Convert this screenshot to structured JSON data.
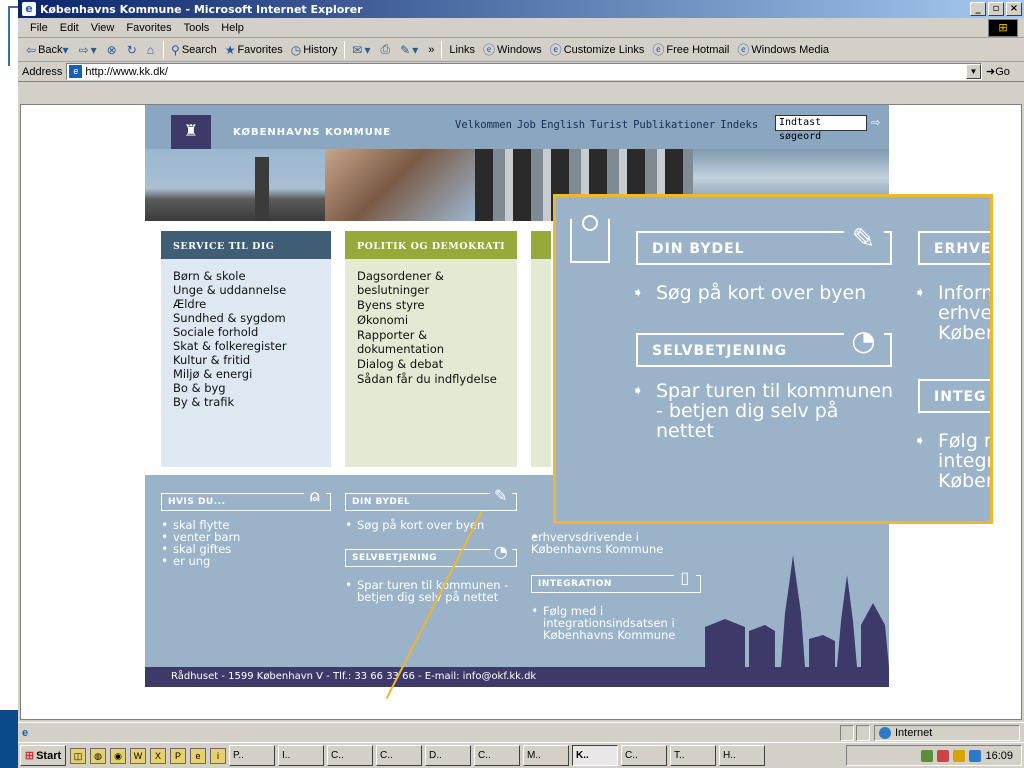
{
  "window": {
    "title": "Københavns Kommune - Microsoft Internet Explorer",
    "buttons": [
      "_",
      "▫",
      "×"
    ]
  },
  "menu": [
    "File",
    "Edit",
    "View",
    "Favorites",
    "Tools",
    "Help"
  ],
  "toolbar": {
    "back": "Back",
    "search": "Search",
    "favorites": "Favorites",
    "history": "History",
    "chevron": "»",
    "links_label": "Links",
    "links": [
      "Windows",
      "Customize Links",
      "Free Hotmail",
      "Windows Media"
    ]
  },
  "address": {
    "label": "Address",
    "url": "http://www.kk.dk/",
    "go": "Go"
  },
  "site": {
    "name": "KØBENHAVNS KOMMUNE",
    "topnav": [
      "Velkommen",
      "Job",
      "English",
      "Turist",
      "Publikationer",
      "Indeks"
    ],
    "search_placeholder": "Indtast søgeord",
    "service": {
      "title": "SERVICE TIL DIG",
      "items": [
        "Børn & skole",
        "Unge & uddannelse",
        "Ældre",
        "Sundhed & sygdom",
        "Sociale forhold",
        "Skat & folkeregister",
        "Kultur & fritid",
        "Miljø & energi",
        "Bo & byg",
        "By & trafik"
      ]
    },
    "politik": {
      "title": "POLITIK OG DEMOKRATI",
      "items": [
        "Dagsordener & beslutninger",
        "Byens styre",
        "Økonomi",
        "Rapporter & dokumentation",
        "Dialog & debat",
        "Sådan får du indflydelse"
      ]
    },
    "hvis_du": {
      "title": "HVIS DU...",
      "items": [
        "skal flytte",
        "venter barn",
        "skal giftes",
        "er ung"
      ]
    },
    "din_bydel": {
      "title": "DIN BYDEL",
      "text": "Søg på kort over byen"
    },
    "selvbetjening": {
      "title": "SELVBETJENING",
      "text": "Spar turen til kommunen - betjen dig selv på nettet"
    },
    "erhverv_text": "erhvervsdrivende i Københavns Kommune",
    "integration": {
      "title": "INTEGRATION",
      "text": "Følg med i integrationsindsatsen i Københavns Kommune"
    },
    "footer": "Rådhuset - 1599 København V - Tlf.: 33 66 33 66 - E-mail: info@okf.kk.dk"
  },
  "zoom": {
    "din_bydel": "DIN BYDEL",
    "din_bydel_text": "Søg på kort over byen",
    "selvbetjening": "SELVBETJENING",
    "selvbetjening_text": "Spar turen til kommunen - betjen dig selv på nettet",
    "erhverv_cut": "ERHVE",
    "erhverv_text_cut": "Inform erhver Køber",
    "integ_cut": "INTEG",
    "integ_text_cut": "Følg m integr Køber"
  },
  "status": {
    "zone": "Internet"
  },
  "taskbar": {
    "start": "Start",
    "tasks": [
      "P..",
      "I..",
      "C..",
      "C..",
      "D..",
      "C..",
      "M..",
      "K..",
      "C..",
      "T..",
      "H.."
    ],
    "active_index": 7,
    "clock": "16:09"
  },
  "colors": {
    "accent": "#f3b52e",
    "header_blue": "#8aa6c1",
    "navy": "#3d3a69",
    "olive": "#97a93a"
  }
}
